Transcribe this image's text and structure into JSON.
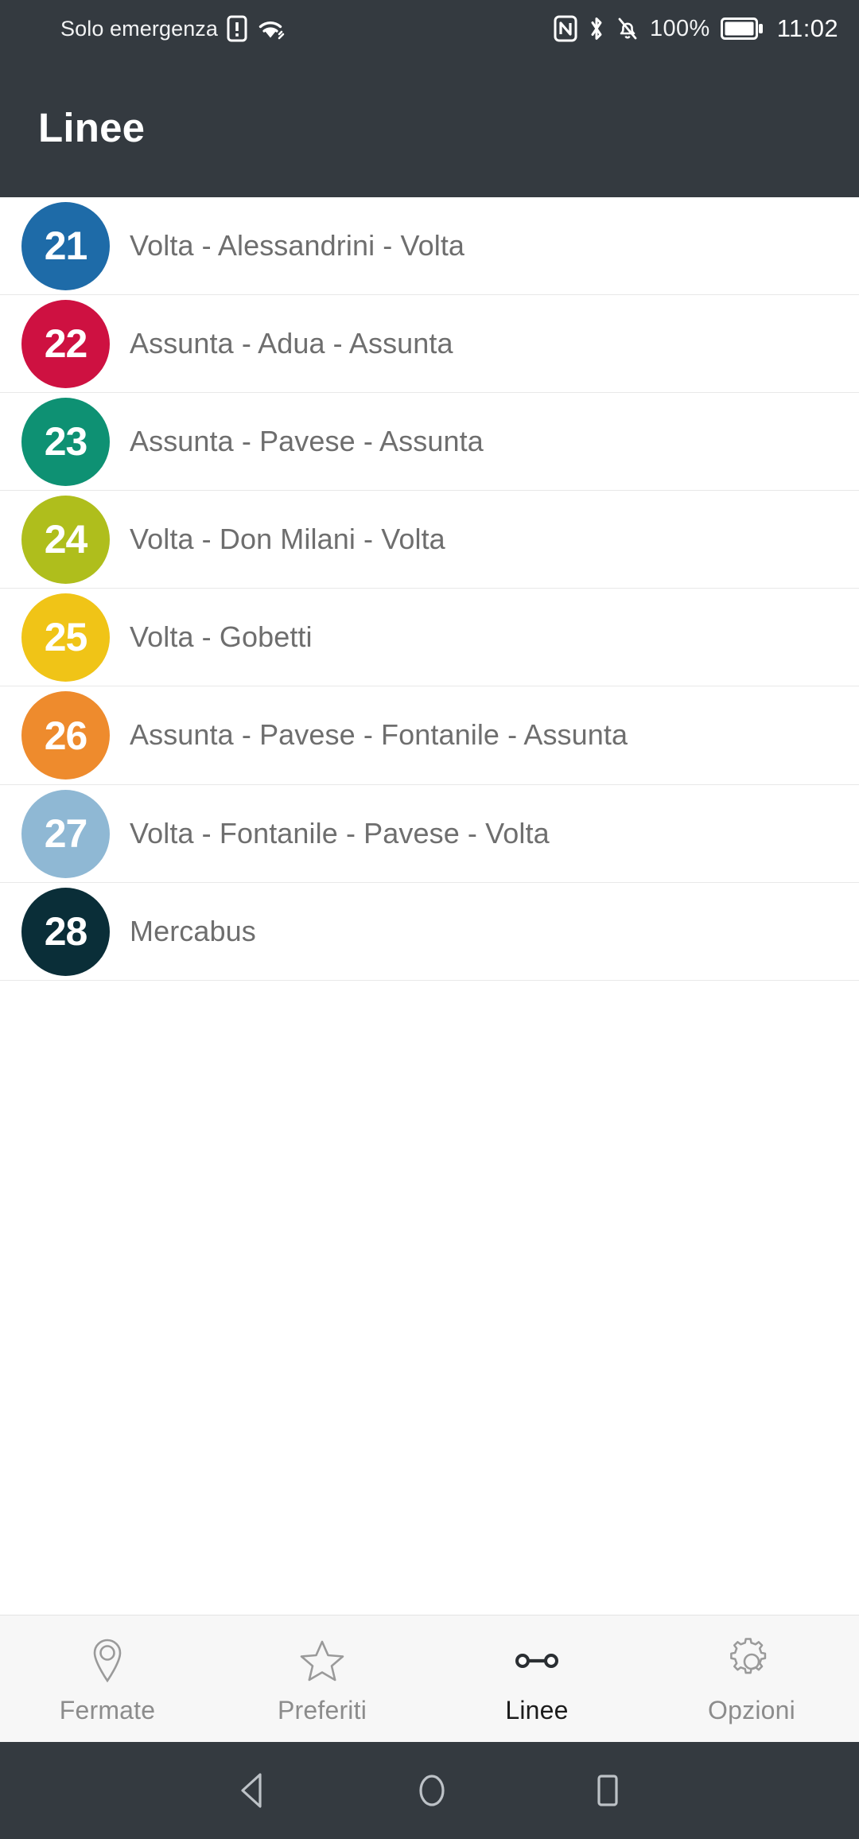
{
  "status_bar": {
    "carrier_text": "Solo emergenza",
    "battery_percent": "100%",
    "time": "11:02",
    "icons": [
      "sim-alert-icon",
      "wifi-icon",
      "nfc-icon",
      "bluetooth-icon",
      "bell-muted-icon",
      "battery-icon"
    ],
    "background": "#343a40"
  },
  "header": {
    "title": "Linee",
    "background": "#343a40"
  },
  "lines": [
    {
      "number": "21",
      "name": "Volta - Alessandrini - Volta",
      "color": "#1e6ba8"
    },
    {
      "number": "22",
      "name": "Assunta - Adua - Assunta",
      "color": "#ce1141"
    },
    {
      "number": "23",
      "name": "Assunta - Pavese - Assunta",
      "color": "#0e9173"
    },
    {
      "number": "24",
      "name": "Volta - Don Milani - Volta",
      "color": "#afbe1c"
    },
    {
      "number": "25",
      "name": "Volta - Gobetti",
      "color": "#f0c417"
    },
    {
      "number": "26",
      "name": "Assunta - Pavese - Fontanile - Assunta",
      "color": "#ee8b2d"
    },
    {
      "number": "27",
      "name": "Volta - Fontanile - Pavese - Volta",
      "color": "#8fb8d4"
    },
    {
      "number": "28",
      "name": "Mercabus",
      "color": "#0a2e38"
    }
  ],
  "tabbar": {
    "background": "#f7f7f7",
    "active_index": 2,
    "tabs": [
      {
        "label": "Fermate",
        "icon": "map-pin-icon"
      },
      {
        "label": "Preferiti",
        "icon": "star-icon"
      },
      {
        "label": "Linee",
        "icon": "route-line-icon"
      },
      {
        "label": "Opzioni",
        "icon": "gear-icon"
      }
    ]
  },
  "system_nav": {
    "background": "#343a40",
    "buttons": [
      {
        "icon": "back-triangle-icon"
      },
      {
        "icon": "home-circle-icon"
      },
      {
        "icon": "recents-square-icon"
      }
    ]
  }
}
